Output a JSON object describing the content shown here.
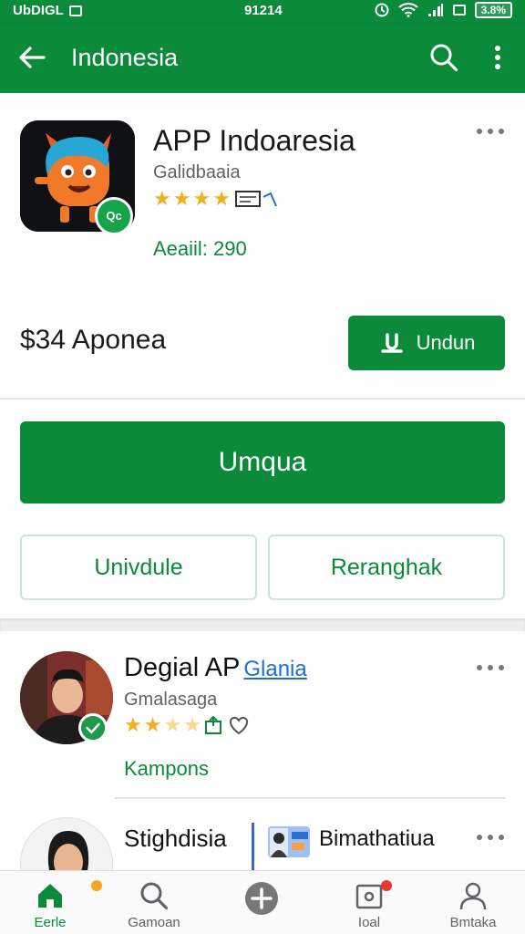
{
  "status_bar": {
    "left_text": "UbDIGL",
    "time": "91214",
    "battery": "3.8%"
  },
  "app_bar": {
    "title": "Indonesia"
  },
  "hero": {
    "app_name": "APP Indoaresia",
    "developer": "Galidbaaia",
    "rating_stars": 4,
    "availability": "Aeaiil: 290",
    "price_label": "$34 Aponea",
    "small_button_label": "Undun",
    "badge_text": "Qc"
  },
  "actions": {
    "primary_label": "Umqua",
    "secondary_left_label": "Univdule",
    "secondary_right_label": "Reranghak"
  },
  "list": {
    "items": [
      {
        "title": "Degial AP",
        "tag": "Glania",
        "subtitle": "Gmalasaga",
        "rating_stars": 2.5,
        "link": "Kampons"
      },
      {
        "title": "Stighdisia",
        "right_title": "Bimathatiua"
      }
    ]
  },
  "bottom_nav": {
    "items": [
      {
        "label": "Eerle",
        "icon": "home-icon",
        "active": true
      },
      {
        "label": "Gamoan",
        "icon": "search-icon",
        "active": false
      },
      {
        "label": "",
        "icon": "add-circle-icon",
        "active": false
      },
      {
        "label": "Ioal",
        "icon": "notification-icon",
        "active": false
      },
      {
        "label": "Bmtaka",
        "icon": "profile-icon",
        "active": false
      }
    ]
  },
  "colors": {
    "primary": "#0b8a3a",
    "star": "#f2b01e",
    "link": "#1d6fd8"
  }
}
